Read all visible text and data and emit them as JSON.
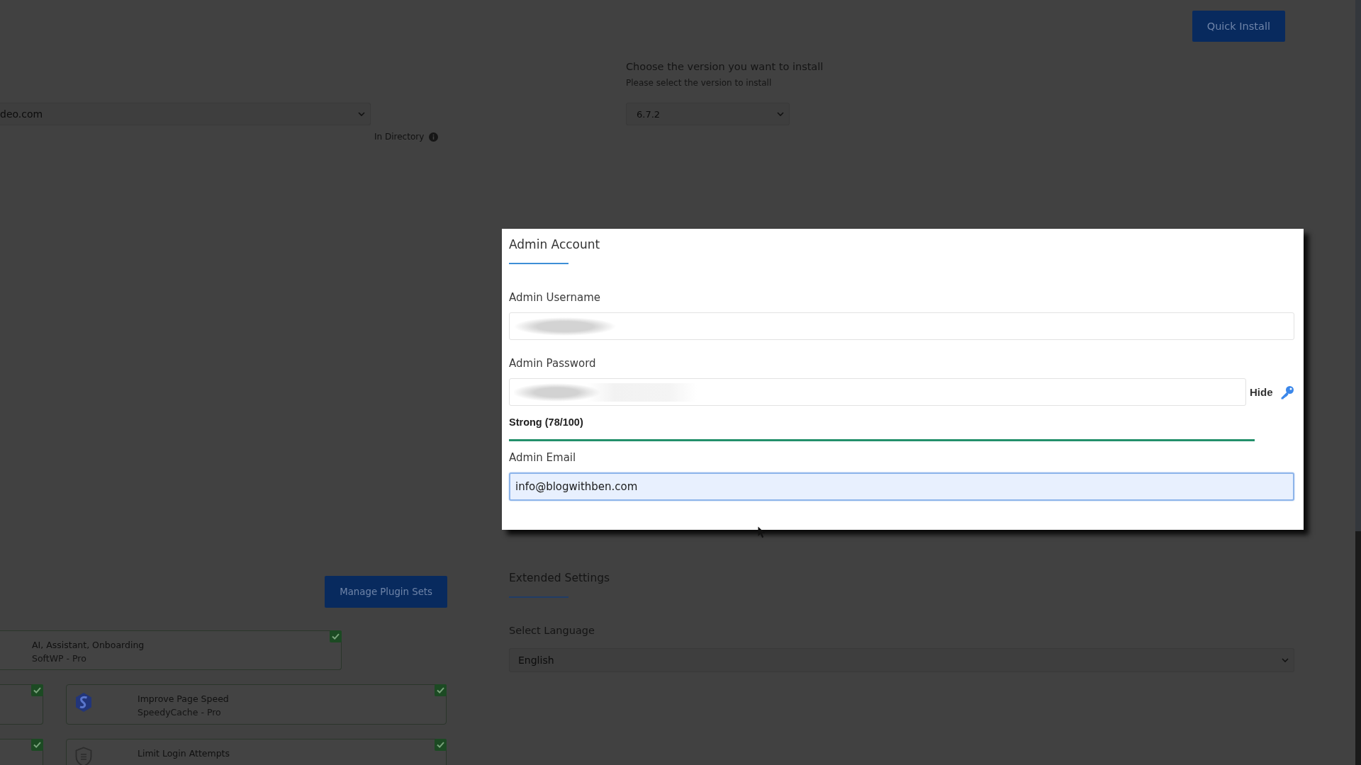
{
  "header": {
    "quick_install": "Quick Install"
  },
  "version": {
    "title": "Choose the version you want to install",
    "subtitle": "Please select the version to install",
    "value": "6.7.2"
  },
  "install_target": {
    "domain": "deo.com",
    "directory_label": "In Directory"
  },
  "admin_account": {
    "title": "Admin Account",
    "fields": [
      {
        "kind": "text",
        "label": "Admin Username",
        "blurred": true,
        "focused": false
      },
      {
        "kind": "password",
        "label": "Admin Password",
        "blurred": true,
        "focused": false,
        "toggle": "Hide",
        "strength": {
          "label": "Strong (78/100)",
          "level": 1
        }
      },
      {
        "kind": "text",
        "label": "Admin Email",
        "value": "info@blogwithben.com",
        "blurred": false,
        "focused": true
      }
    ]
  },
  "plugin_sets": {
    "button": "Manage Plugin Sets",
    "plugins": [
      {
        "kind": "wide",
        "title": "AI, Assistant, Onboarding",
        "subtitle": "SoftWP - Pro",
        "checked": true
      },
      {
        "kind": "stub",
        "checked": true
      },
      {
        "kind": "cache",
        "title": "Improve Page Speed",
        "subtitle": "SpeedyCache - Pro",
        "checked": true
      },
      {
        "kind": "stub",
        "checked": true
      },
      {
        "kind": "shield",
        "title": "Limit Login Attempts",
        "checked": true
      }
    ]
  },
  "extended_settings": {
    "title": "Extended Settings",
    "language": {
      "label": "Select Language",
      "value": "English"
    }
  }
}
